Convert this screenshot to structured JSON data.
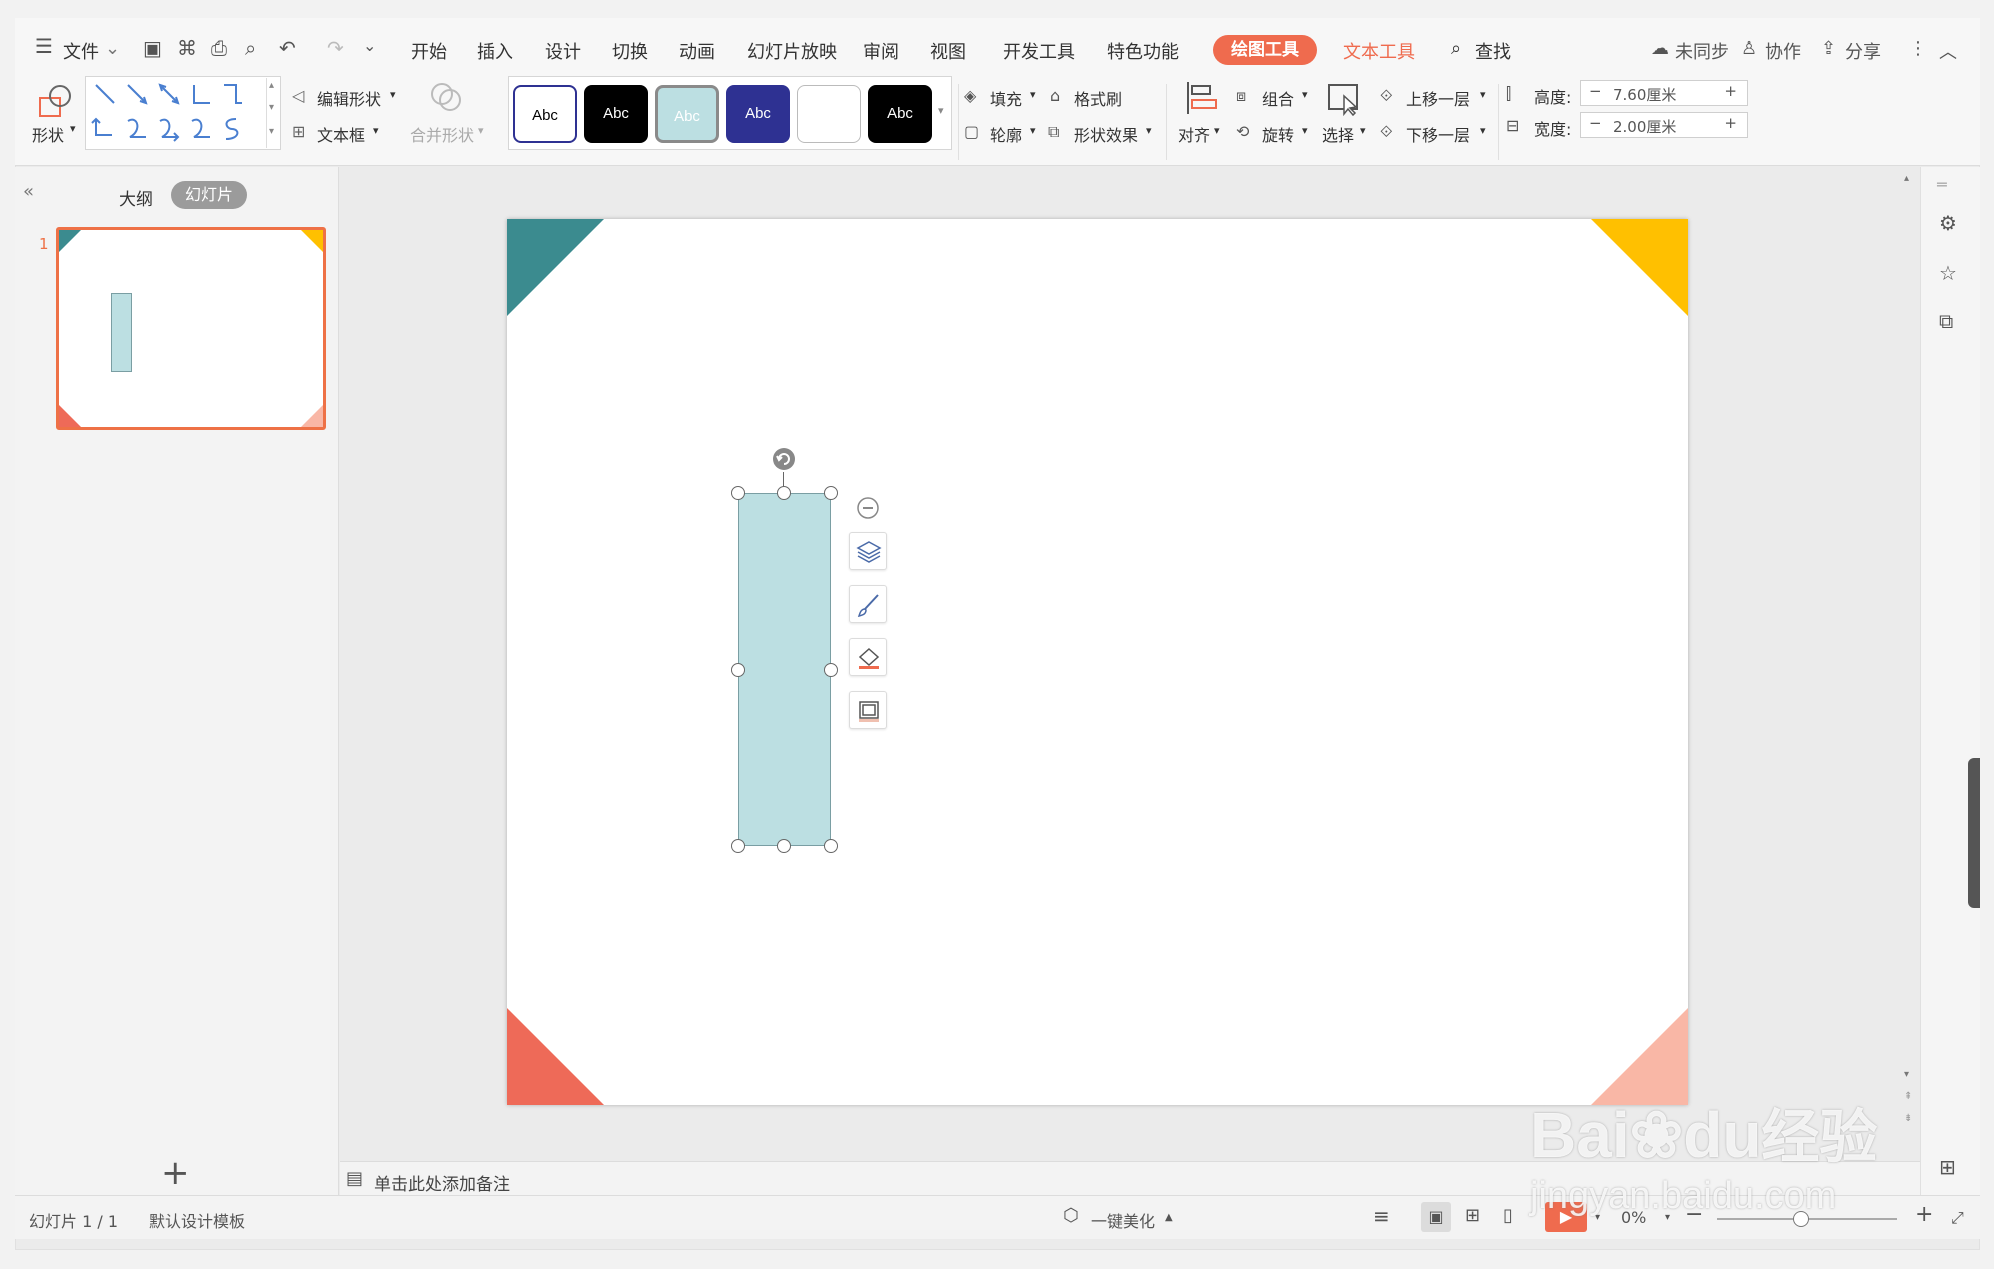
{
  "menu": {
    "file": "文件",
    "tabs": [
      "开始",
      "插入",
      "设计",
      "切换",
      "动画",
      "幻灯片放映",
      "审阅",
      "视图",
      "开发工具",
      "特色功能"
    ],
    "active_tab": "绘图工具",
    "text_tool_tab": "文本工具",
    "search": "查找",
    "sync": "未同步",
    "collab": "协作",
    "share": "分享"
  },
  "ribbon": {
    "shape": "形状",
    "edit_shape": "编辑形状",
    "text_box": "文本框",
    "merge_shape": "合并形状",
    "style_labels": [
      "Abc",
      "Abc",
      "Abc",
      "Abc",
      "",
      "Abc"
    ],
    "fill": "填充",
    "format_painter": "格式刷",
    "outline": "轮廓",
    "shape_effect": "形状效果",
    "align": "对齐",
    "group": "组合",
    "rotate": "旋转",
    "select": "选择",
    "bring_forward": "上移一层",
    "send_backward": "下移一层",
    "height_label": "高度:",
    "height_value": "7.60厘米",
    "width_label": "宽度:",
    "width_value": "2.00厘米"
  },
  "left_pane": {
    "outline_tab": "大纲",
    "slides_tab": "幻灯片",
    "slide_number": "1"
  },
  "notes_placeholder": "单击此处添加备注",
  "status": {
    "slide_counter": "幻灯片 1 / 1",
    "template": "默认设计模板",
    "beautify": "一键美化",
    "zoom": "0%"
  },
  "watermark": {
    "brand": "Bai",
    "brand2": "du",
    "cn": "经验",
    "url": "jingyan.baidu.com"
  },
  "colors": {
    "teal": "#3b8b8f",
    "yellow": "#ffc000",
    "coral": "#ee6a58",
    "peach": "#f9b7a6",
    "shape_fill": "#bcdfe2",
    "accent": "#ef6b4e"
  }
}
